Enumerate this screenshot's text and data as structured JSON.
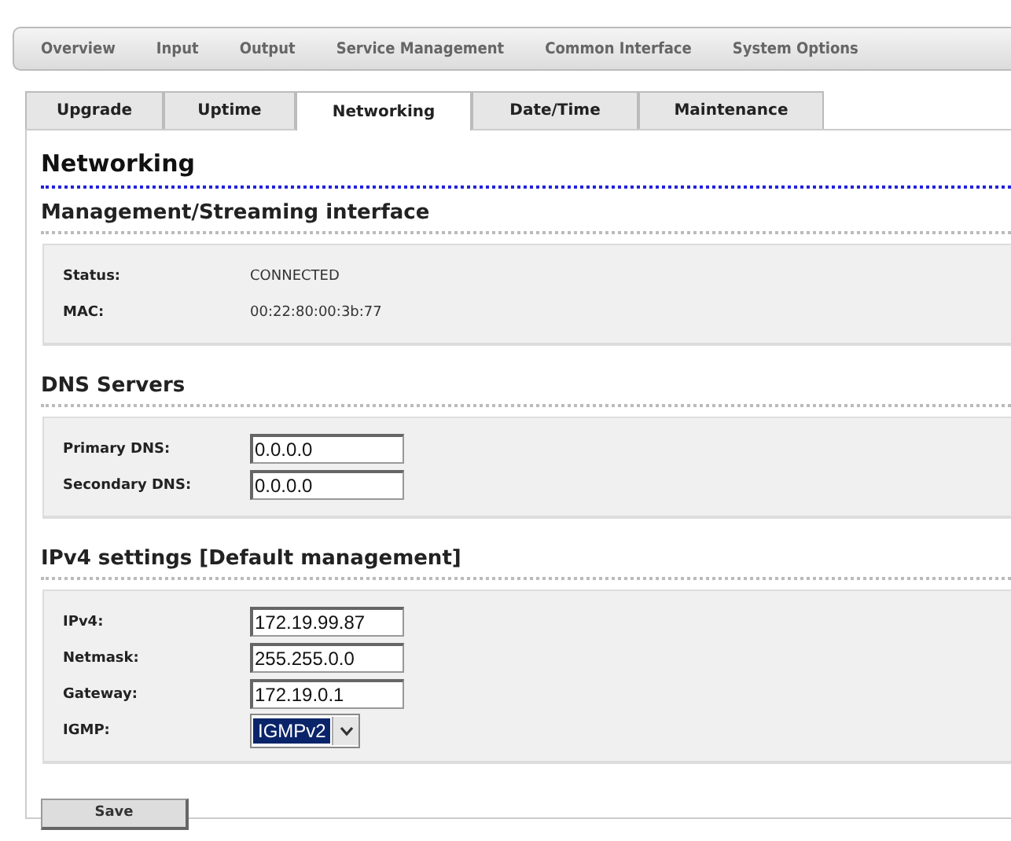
{
  "nav": [
    {
      "label": "Overview"
    },
    {
      "label": "Input"
    },
    {
      "label": "Output"
    },
    {
      "label": "Service Management"
    },
    {
      "label": "Common Interface"
    },
    {
      "label": "System Options"
    }
  ],
  "tabs": [
    {
      "label": "Upgrade",
      "selected": false
    },
    {
      "label": "Uptime",
      "selected": false
    },
    {
      "label": "Networking",
      "selected": true
    },
    {
      "label": "Date/Time",
      "selected": false
    },
    {
      "label": "Maintenance",
      "selected": false
    }
  ],
  "page_title": "Networking",
  "sections": [
    {
      "title": "Management/Streaming interface",
      "rows": [
        {
          "kind": "text",
          "label": "Status:",
          "value": "CONNECTED"
        },
        {
          "kind": "text",
          "label": "MAC:",
          "value": "00:22:80:00:3b:77"
        }
      ]
    },
    {
      "title": "DNS Servers",
      "rows": [
        {
          "kind": "input",
          "label": "Primary DNS:",
          "value": "0.0.0.0"
        },
        {
          "kind": "input",
          "label": "Secondary DNS:",
          "value": "0.0.0.0"
        }
      ]
    },
    {
      "title": "IPv4 settings [Default management]",
      "rows": [
        {
          "kind": "input",
          "label": "IPv4:",
          "value": "172.19.99.87"
        },
        {
          "kind": "input",
          "label": "Netmask:",
          "value": "255.255.0.0"
        },
        {
          "kind": "input",
          "label": "Gateway:",
          "value": "172.19.0.1"
        },
        {
          "kind": "select",
          "label": "IGMP:",
          "value": "IGMPv2"
        }
      ]
    }
  ],
  "save_button": "Save"
}
